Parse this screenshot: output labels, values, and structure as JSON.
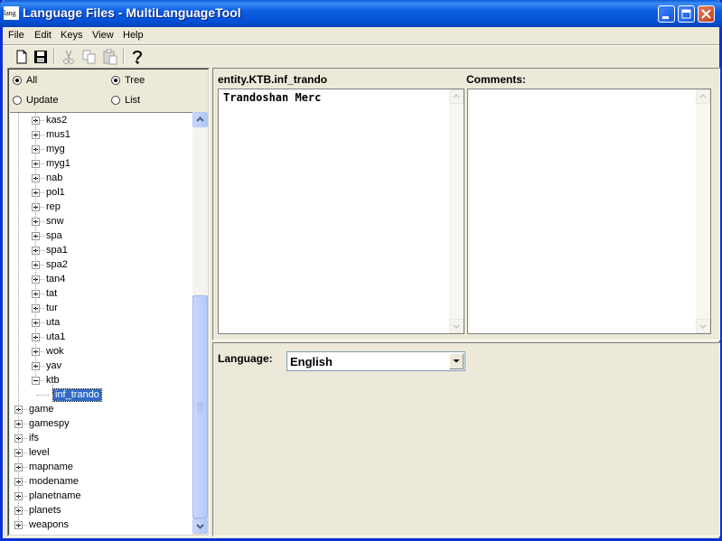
{
  "window": {
    "title": "Language Files - MultiLanguageTool",
    "icon_text": "lang"
  },
  "menu": [
    "File",
    "Edit",
    "Keys",
    "View",
    "Help"
  ],
  "toolbar": [
    "new-file-icon",
    "save-icon",
    "cut-icon",
    "copy-icon",
    "paste-icon",
    "help-icon"
  ],
  "filters": {
    "all": "All",
    "update": "Update",
    "tree": "Tree",
    "list": "List",
    "selected_filter": "All",
    "selected_view": "Tree"
  },
  "tree": {
    "children": [
      "kas2",
      "mus1",
      "myg",
      "myg1",
      "nab",
      "pol1",
      "rep",
      "snw",
      "spa",
      "spa1",
      "spa2",
      "tan4",
      "tat",
      "tur",
      "uta",
      "uta1",
      "wok",
      "yav"
    ],
    "expanded": "ktb",
    "expanded_child": "inf_trando",
    "roots": [
      "game",
      "gamespy",
      "ifs",
      "level",
      "mapname",
      "modename",
      "planetname",
      "planets",
      "weapons"
    ]
  },
  "editor": {
    "key_label": "entity.KTB.inf_trando",
    "comments_label": "Comments:",
    "value_text": "Trandoshan Merc",
    "comments_text": ""
  },
  "language": {
    "label": "Language:",
    "selected": "English"
  }
}
